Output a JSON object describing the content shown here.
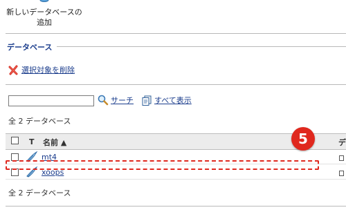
{
  "toolbar": {
    "add_db_line1": "新しいデータベースの",
    "add_db_line2": "追加"
  },
  "section": {
    "title": "データベース"
  },
  "actions": {
    "delete_selected": "選択対象を削除",
    "search": "サーチ",
    "show_all": "すべて表示"
  },
  "search": {
    "value": "",
    "placeholder": ""
  },
  "summary": {
    "count_top": "全 2 データベース",
    "count_bottom": "全 2 データベース"
  },
  "table": {
    "col_type": "T",
    "col_name": "名前 ▲",
    "col_next": "デ",
    "rows": [
      {
        "name": "mt4"
      },
      {
        "name": "xoops"
      }
    ]
  },
  "annotation": {
    "step_number": "5"
  },
  "colors": {
    "link": "#1a3c8c",
    "accent_red": "#e0281e",
    "header_bg": "#ececec"
  },
  "icons": {
    "add_db": "database-icon",
    "delete": "red-x-icon",
    "search": "magnifier-icon",
    "show_all": "documents-icon",
    "row": "database-feather-icon"
  }
}
